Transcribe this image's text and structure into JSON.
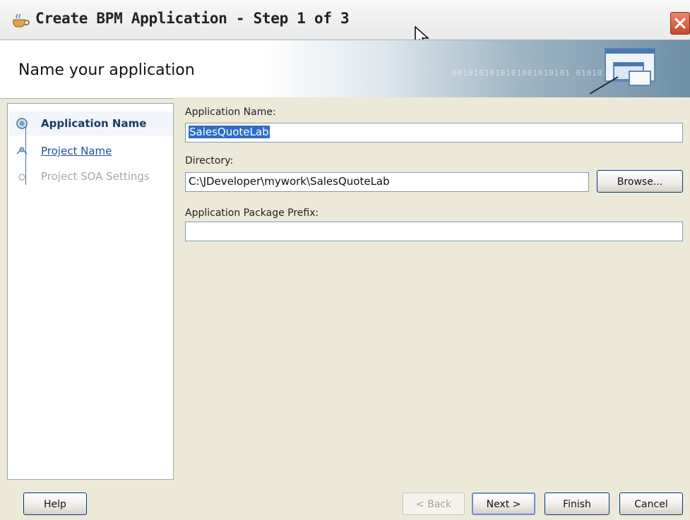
{
  "window": {
    "title": "Create BPM Application - Step 1 of 3"
  },
  "banner": {
    "title": "Name your application",
    "binary_text": "0010101010101001010101 01010101010"
  },
  "nav": {
    "steps": [
      {
        "label": "Application Name",
        "state": "current"
      },
      {
        "label": "Project Name",
        "state": "link"
      },
      {
        "label": "Project SOA Settings",
        "state": "disabled"
      }
    ]
  },
  "form": {
    "app_name_label": "Application Name:",
    "app_name_value": "SalesQuoteLab",
    "directory_label": "Directory:",
    "directory_value": "C:\\JDeveloper\\mywork\\SalesQuoteLab",
    "browse_label": "Browse...",
    "prefix_label": "Application Package Prefix:",
    "prefix_value": ""
  },
  "footer": {
    "help_label": "Help",
    "back_label": "< Back",
    "next_label": "Next >",
    "finish_label": "Finish",
    "cancel_label": "Cancel"
  },
  "colors": {
    "accent": "#003c74",
    "selection": "#2f6cc8",
    "close": "#c8462d"
  },
  "icons": {
    "title": "coffee-cup-icon",
    "banner": "windows-wizard-icon",
    "close": "close-icon"
  }
}
